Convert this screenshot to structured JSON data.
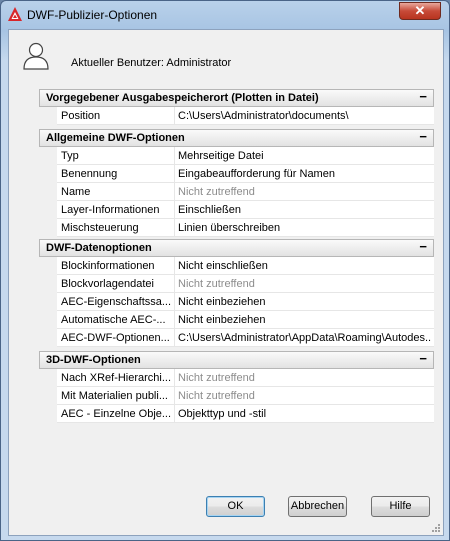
{
  "window": {
    "title": "DWF-Publizier-Optionen",
    "close_symbol": "✕"
  },
  "user": {
    "label": "Aktueller Benutzer: Administrator"
  },
  "categories": [
    {
      "title": "Vorgegebener Ausgabespeicherort (Plotten in Datei)",
      "toggle": "−",
      "rows": [
        {
          "name": "Position",
          "value": "C:\\Users\\Administrator\\documents\\",
          "disabled": false
        }
      ]
    },
    {
      "title": "Allgemeine DWF-Optionen",
      "toggle": "−",
      "rows": [
        {
          "name": "Typ",
          "value": "Mehrseitige Datei",
          "disabled": false
        },
        {
          "name": "Benennung",
          "value": "Eingabeaufforderung für Namen",
          "disabled": false
        },
        {
          "name": "Name",
          "value": "Nicht zutreffend",
          "disabled": true
        },
        {
          "name": "Layer-Informationen",
          "value": "Einschließen",
          "disabled": false
        },
        {
          "name": "Mischsteuerung",
          "value": "Linien überschreiben",
          "disabled": false
        }
      ]
    },
    {
      "title": "DWF-Datenoptionen",
      "toggle": "−",
      "rows": [
        {
          "name": "Blockinformationen",
          "value": "Nicht einschließen",
          "disabled": false
        },
        {
          "name": "Blockvorlagendatei",
          "value": "Nicht zutreffend",
          "disabled": true
        },
        {
          "name": "AEC-Eigenschaftssa...",
          "value": "Nicht einbeziehen",
          "disabled": false
        },
        {
          "name": "Automatische AEC-...",
          "value": "Nicht einbeziehen",
          "disabled": false
        },
        {
          "name": "AEC-DWF-Optionen...",
          "value": "C:\\Users\\Administrator\\AppData\\Roaming\\Autodes...",
          "disabled": false
        }
      ]
    },
    {
      "title": "3D-DWF-Optionen",
      "toggle": "−",
      "rows": [
        {
          "name": "Nach XRef-Hierarchi...",
          "value": "Nicht zutreffend",
          "disabled": true
        },
        {
          "name": "Mit Materialien publi...",
          "value": "Nicht zutreffend",
          "disabled": true
        },
        {
          "name": "AEC - Einzelne Obje...",
          "value": "Objekttyp und -stil",
          "disabled": false
        }
      ]
    }
  ],
  "buttons": {
    "ok": "OK",
    "cancel": "Abbrechen",
    "help": "Hilfe"
  }
}
